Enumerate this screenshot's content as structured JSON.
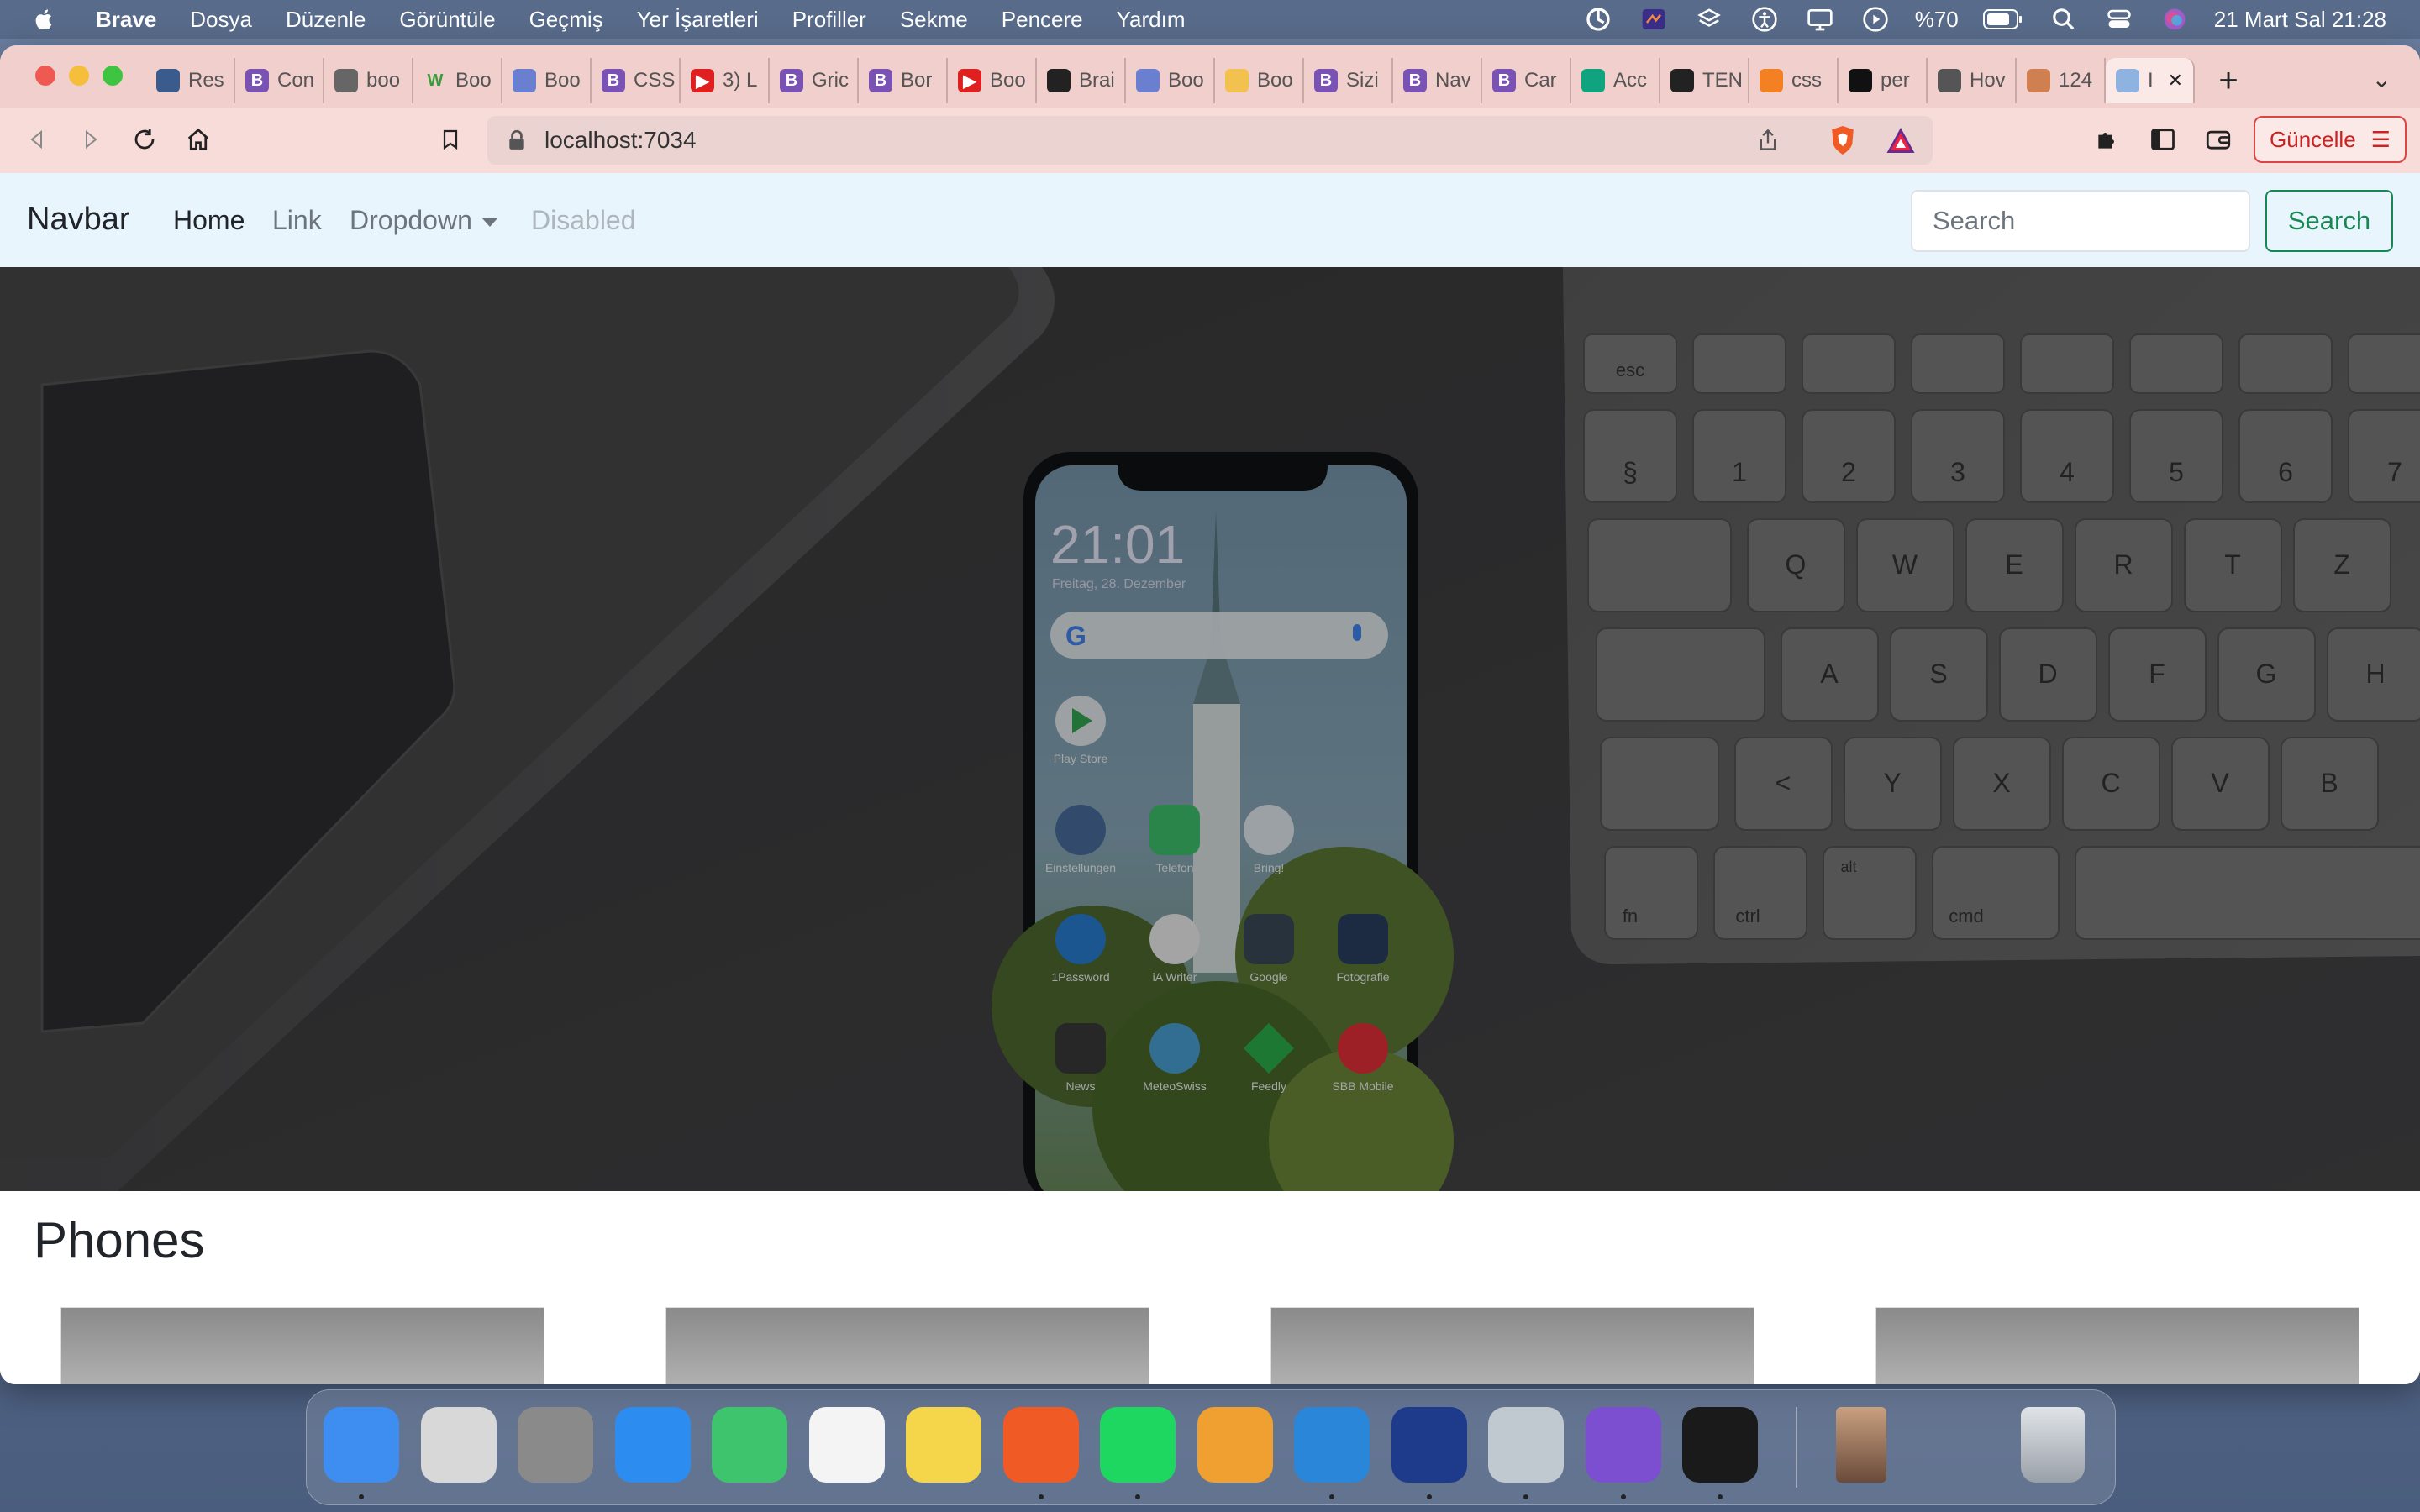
{
  "menubar": {
    "app": "Brave",
    "items": [
      "Dosya",
      "Düzenle",
      "Görüntüle",
      "Geçmiş",
      "Yer İşaretleri",
      "Profiller",
      "Sekme",
      "Pencere",
      "Yardım"
    ],
    "battery": "%70",
    "datetime": "21 Mart Sal  21:28"
  },
  "tabs": [
    {
      "label": "Res",
      "icon": "monitor-icon",
      "color": "#3b5b8c"
    },
    {
      "label": "Con",
      "icon": "bootstrap-icon",
      "color": "#7952b3"
    },
    {
      "label": "boo",
      "icon": "globe-icon",
      "color": "#666666"
    },
    {
      "label": "Boo",
      "icon": "w-icon",
      "color": "#3a9b3a"
    },
    {
      "label": "Boo",
      "icon": "w3-icon",
      "color": "#6a7fd0"
    },
    {
      "label": "CSS",
      "icon": "bootstrap-icon",
      "color": "#7952b3"
    },
    {
      "label": "3) L",
      "icon": "youtube-icon",
      "color": "#e02020"
    },
    {
      "label": "Gric",
      "icon": "bootstrap-icon",
      "color": "#7952b3"
    },
    {
      "label": "Bor",
      "icon": "bootstrap-icon",
      "color": "#7952b3"
    },
    {
      "label": "Boo",
      "icon": "youtube-icon",
      "color": "#e02020"
    },
    {
      "label": "Brai",
      "icon": "github-icon",
      "color": "#222222"
    },
    {
      "label": "Boo",
      "icon": "w3-icon",
      "color": "#6a7fd0"
    },
    {
      "label": "Boo",
      "icon": "circle-icon",
      "color": "#f2c14e"
    },
    {
      "label": "Sizi",
      "icon": "bootstrap-icon",
      "color": "#7952b3"
    },
    {
      "label": "Nav",
      "icon": "bootstrap-icon",
      "color": "#7952b3"
    },
    {
      "label": "Car",
      "icon": "bootstrap-icon",
      "color": "#7952b3"
    },
    {
      "label": "Acc",
      "icon": "openai-icon",
      "color": "#10a37f"
    },
    {
      "label": "TEN",
      "icon": "globe-icon",
      "color": "#222222"
    },
    {
      "label": "css",
      "icon": "stackoverflow-icon",
      "color": "#f48024"
    },
    {
      "label": "per",
      "icon": "unsplash-icon",
      "color": "#111111"
    },
    {
      "label": "Hov",
      "icon": "codepen-icon",
      "color": "#555555"
    },
    {
      "label": "124",
      "icon": "avatar-icon",
      "color": "#d08050"
    },
    {
      "label": "I",
      "icon": "page-icon",
      "color": "#8fb3e0"
    }
  ],
  "toolbar": {
    "url": "localhost:7034",
    "update_label": "Güncelle"
  },
  "navbar": {
    "brand": "Navbar",
    "links": [
      "Home",
      "Link",
      "Dropdown",
      "Disabled"
    ],
    "search_placeholder": "Search",
    "search_button": "Search"
  },
  "phone_screen": {
    "time": "21:01",
    "date": "Freitag, 28. Dezember",
    "apps": [
      "Play Store",
      "Einstellungen",
      "Telefon",
      "Bring!",
      "1Password",
      "iA Writer",
      "Google",
      "Fotografie",
      "News",
      "MeteoSwiss",
      "Feedly",
      "SBB Mobile"
    ]
  },
  "keyboard": {
    "keys_row1": [
      "esc"
    ],
    "keys_row2": [
      "§",
      "1",
      "2",
      "3",
      "4",
      "5",
      "6",
      "7"
    ],
    "keys_row3": [
      "Q",
      "W",
      "E",
      "R",
      "T",
      "Z"
    ],
    "keys_row4": [
      "A",
      "S",
      "D",
      "F",
      "G",
      "H"
    ],
    "keys_row5": [
      "<",
      "Y",
      "X",
      "C",
      "V",
      "B"
    ],
    "keys_row6": [
      "fn",
      "ctrl",
      "alt",
      "cmd"
    ]
  },
  "section": {
    "title": "Phones"
  },
  "dock": {
    "apps": [
      "Finder",
      "Launchpad",
      "System Preferences",
      "Safari",
      "FaceTime",
      "Reminders",
      "Notes",
      "Brave",
      "Spotify",
      "Pages",
      "Visual Studio Code",
      "Mattermost",
      "Preview",
      "Visual Studio",
      "Terminal"
    ]
  }
}
